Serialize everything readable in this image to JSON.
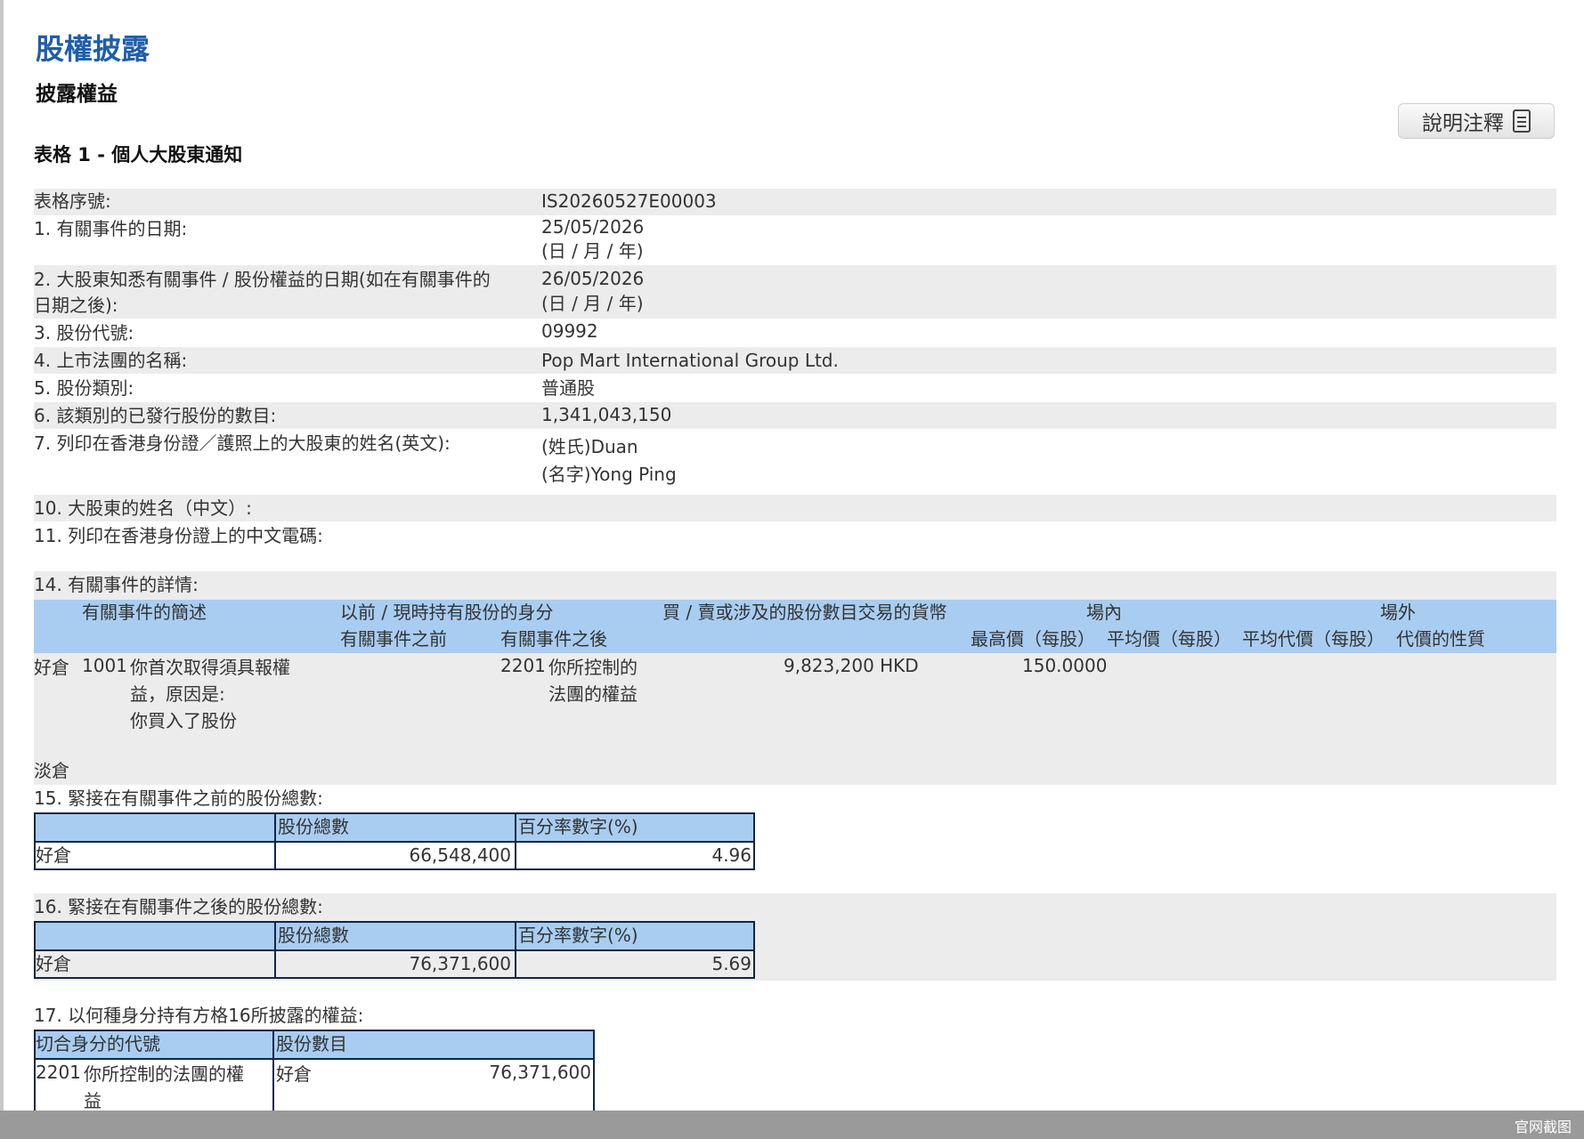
{
  "header": {
    "title": "股權披露",
    "subtitle": "披露權益",
    "form_title": "表格 1 - 個人大股東通知",
    "notes_button": "說明注釋"
  },
  "fields": {
    "form_no_label": "表格序號:",
    "form_no": "IS20260527E00003",
    "f1_label": "1. 有關事件的日期:",
    "f1_value": "25/05/2026",
    "f1_note": "(日 / 月 / 年)",
    "f2_label_1": "2. 大股東知悉有關事件 / 股份權益的日期(如在有關事件的",
    "f2_label_2": "日期之後):",
    "f2_value": "26/05/2026",
    "f2_note": "(日 / 月 / 年)",
    "f3_label": "3. 股份代號:",
    "f3_value": "09992",
    "f4_label": "4. 上市法團的名稱:",
    "f4_value": "Pop Mart International Group Ltd.",
    "f5_label": "5. 股份類別:",
    "f5_value": "普通股",
    "f6_label": "6. 該類別的已發行股份的數目:",
    "f6_value": "1,341,043,150",
    "f7_label": "7. 列印在香港身份證／護照上的大股東的姓名(英文):",
    "f7_surname": "(姓氏)Duan",
    "f7_given": "(名字)Yong Ping",
    "f10_label": "10. 大股東的姓名（中文）:",
    "f11_label": "11. 列印在香港身份證上的中文電碼:"
  },
  "section14": {
    "label": "14. 有關事件的詳情:",
    "headers": {
      "desc": "有關事件的簡述",
      "capacity": "以前 / 現時持有股份的身分",
      "before": "有關事件之前",
      "after": "有關事件之後",
      "shares_currency": "買 / 賣或涉及的股份數目交易的貨幣",
      "on_exchange": "場內",
      "off_exchange": "場外",
      "high_price": "最高價（每股）",
      "avg_price": "平均價（每股）",
      "avg_consideration": "平均代價（每股）",
      "nature": "代價的性質"
    },
    "row": {
      "position": "好倉",
      "code": "1001",
      "desc_1": "你首次取得須具報權",
      "desc_2": "益，原因是:",
      "desc_3": "你買入了股份",
      "after_code": "2201",
      "after_1": "你所控制的",
      "after_2": "法團的權益",
      "shares_currency": "9,823,200 HKD",
      "high_price": "150.0000"
    },
    "short_label": "淡倉"
  },
  "section15": {
    "label": "15. 緊接在有關事件之前的股份總數:",
    "col_total": "股份總數",
    "col_pct": "百分率數字(%)",
    "row_label": "好倉",
    "total": "66,548,400",
    "pct": "4.96"
  },
  "section16": {
    "label": "16. 緊接在有關事件之後的股份總數:",
    "col_total": "股份總數",
    "col_pct": "百分率數字(%)",
    "row_label": "好倉",
    "total": "76,371,600",
    "pct": "5.69"
  },
  "section17": {
    "label": "17. 以何種身分持有方格16所披露的權益:",
    "col_code": "切合身分的代號",
    "col_shares": "股份數目",
    "code": "2201",
    "desc_1": "你所控制的法團的權",
    "desc_2": "益",
    "position": "好倉",
    "shares": "76,371,600"
  },
  "footer": {
    "watermark": "官网截图"
  }
}
